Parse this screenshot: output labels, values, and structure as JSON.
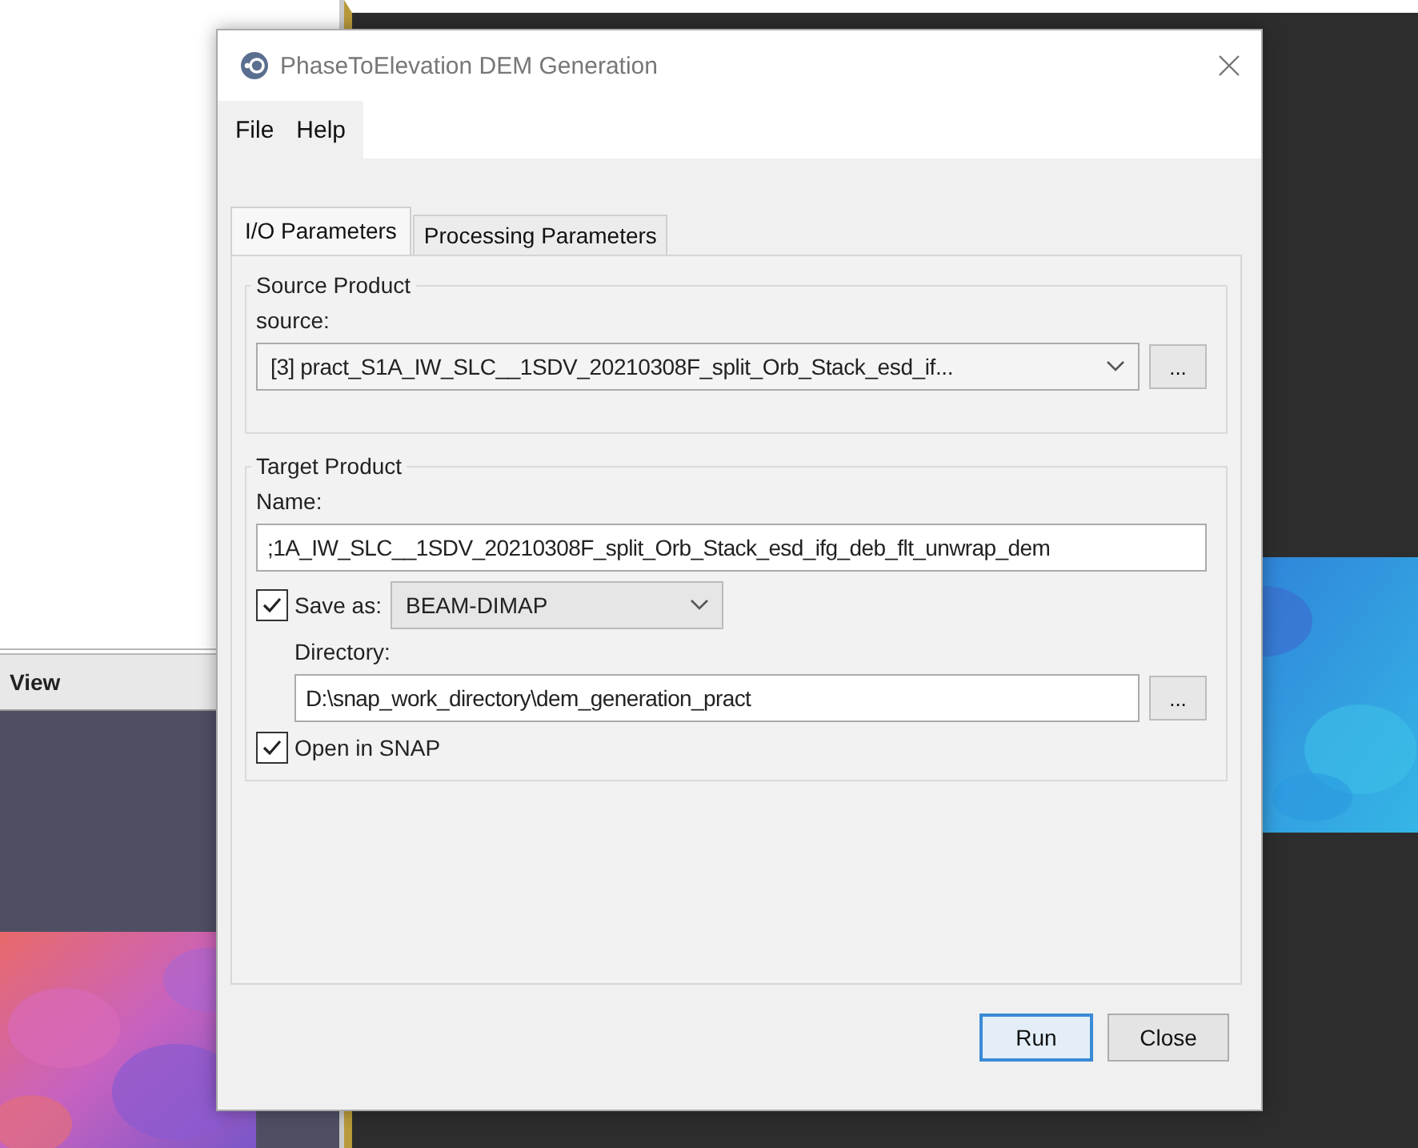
{
  "background_panel": {
    "title": "View"
  },
  "dialog": {
    "title": "PhaseToElevation DEM Generation",
    "menu": [
      {
        "label": "File"
      },
      {
        "label": "Help"
      }
    ],
    "tabs": [
      {
        "label": "I/O Parameters",
        "selected": true
      },
      {
        "label": "Processing Parameters",
        "selected": false
      }
    ],
    "source_product": {
      "heading": "Source Product",
      "label": "source:",
      "value": "[3] pract_S1A_IW_SLC__1SDV_20210308F_split_Orb_Stack_esd_if...",
      "browse": "..."
    },
    "target_product": {
      "heading": "Target Product",
      "name_label": "Name:",
      "name_value": ";1A_IW_SLC__1SDV_20210308F_split_Orb_Stack_esd_ifg_deb_flt_unwrap_dem",
      "save_as": {
        "label": "Save as:",
        "checked": true,
        "format": "BEAM-DIMAP"
      },
      "directory_label": "Directory:",
      "directory_value": "D:\\snap_work_directory\\dem_generation_pract",
      "browse": "...",
      "open_in_snap": {
        "label": "Open in SNAP",
        "checked": true
      }
    },
    "buttons": [
      {
        "label": "Run",
        "default": true
      },
      {
        "label": "Close",
        "default": false
      }
    ]
  }
}
